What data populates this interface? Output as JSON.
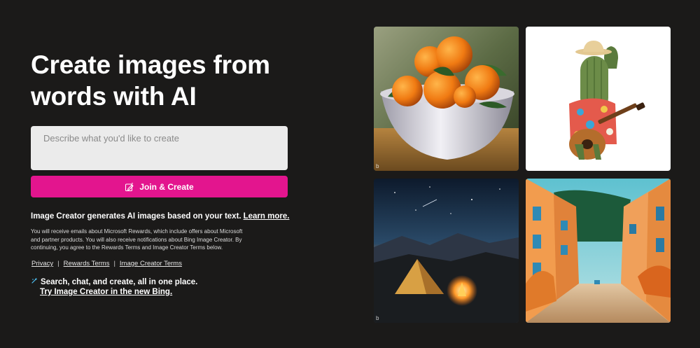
{
  "hero": {
    "title_line1": "Create images from",
    "title_line2": "words with AI"
  },
  "prompt": {
    "placeholder": "Describe what you'd like to create"
  },
  "join_button": {
    "label": "Join & Create",
    "icon": "edit-sparkle-icon"
  },
  "description": {
    "text": "Image Creator generates AI images based on your text.",
    "link": "Learn more."
  },
  "fine_print": "You will receive emails about Microsoft Rewards, which include offers about Microsoft and partner products. You will also receive notifications about Bing Image Creator. By continuing, you agree to the Rewards Terms and Image Creator Terms below.",
  "links": {
    "privacy": "Privacy",
    "rewards_terms": "Rewards Terms",
    "image_creator_terms": "Image Creator Terms",
    "separator": "|"
  },
  "promo": {
    "text": "Search, chat, and create, all in one place.",
    "link": "Try Image Creator in the new Bing.",
    "icon": "sparkle-icon"
  },
  "gallery": {
    "badge": "b",
    "images": [
      "oranges-bowl-painting",
      "cactus-guitar-illustration",
      "tent-campfire-night",
      "colorful-street-town"
    ]
  },
  "colors": {
    "background": "#1b1a19",
    "accent": "#e3158e",
    "input": "#ebebeb"
  }
}
